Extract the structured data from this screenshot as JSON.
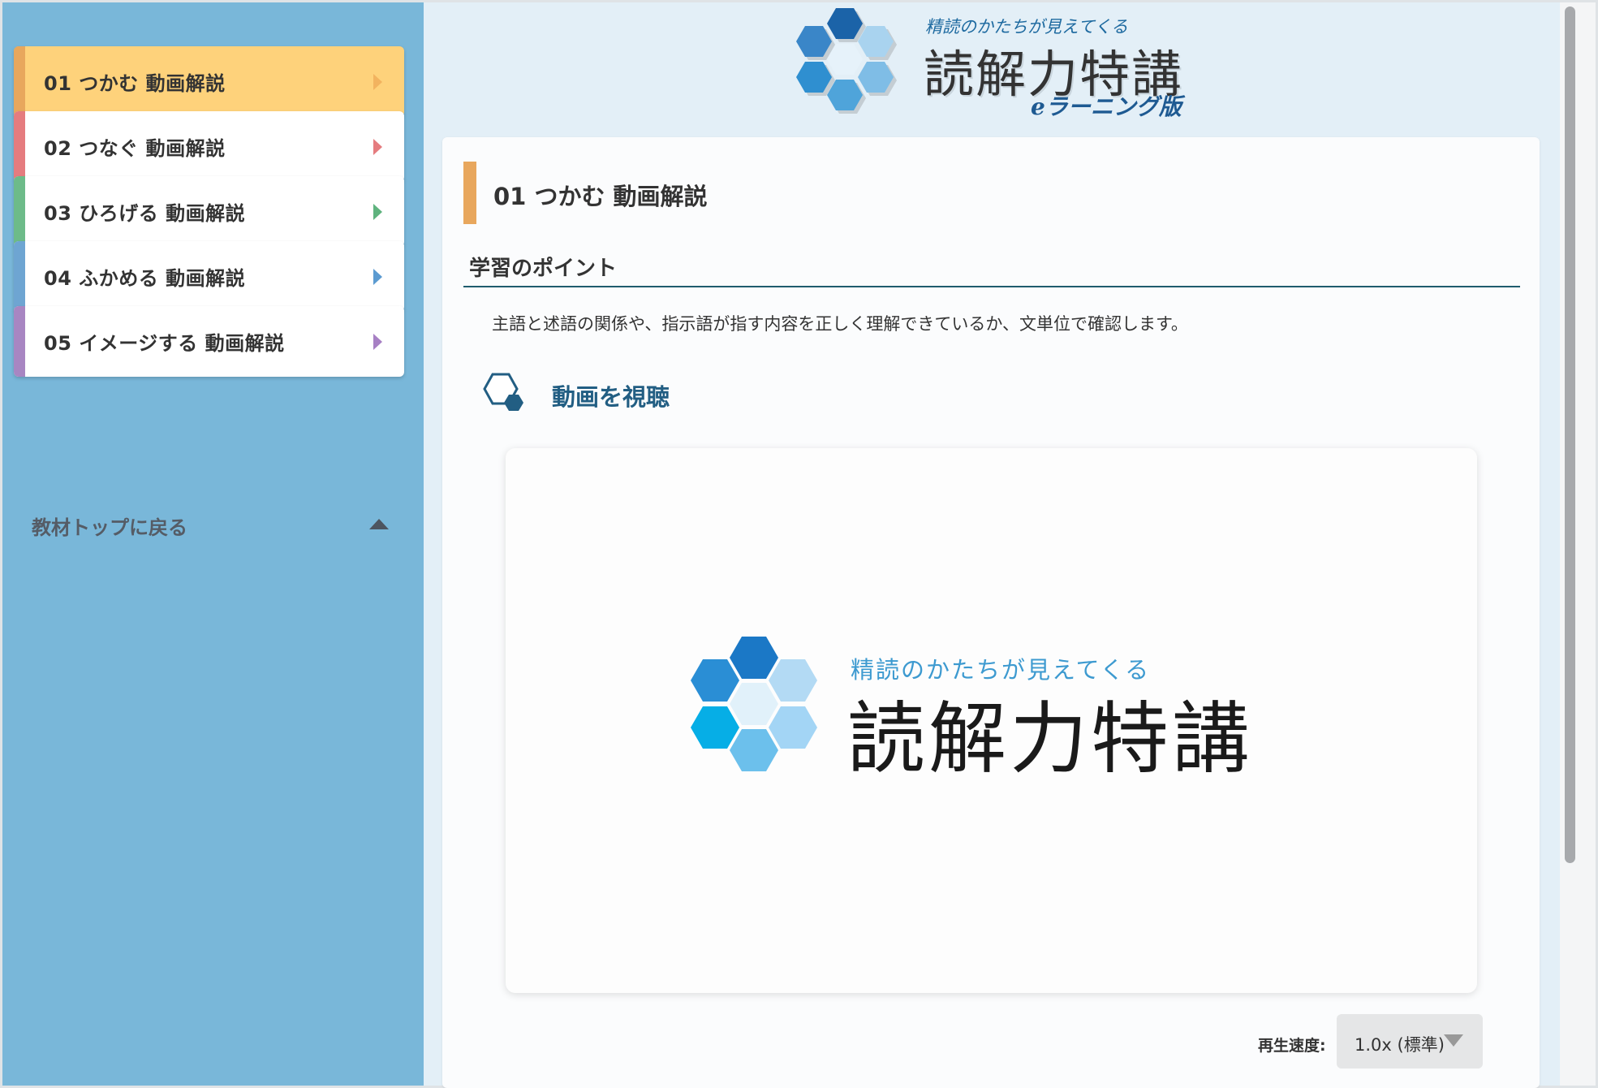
{
  "sidebar": {
    "items": [
      {
        "label": "01 つかむ 動画解説",
        "color": "#e8a75d",
        "arrow_color": "#f2b35f",
        "active": true
      },
      {
        "label": "02 つなぐ 動画解説",
        "color": "#e57c7f",
        "arrow_color": "#e57c7f",
        "active": false
      },
      {
        "label": "03 ひろげる 動画解説",
        "color": "#6dbb89",
        "arrow_color": "#5fb37e",
        "active": false
      },
      {
        "label": "04 ふかめる 動画解説",
        "color": "#6ea5d2",
        "arrow_color": "#5c9bd1",
        "active": false
      },
      {
        "label": "05 イメージする 動画解説",
        "color": "#a886c2",
        "arrow_color": "#a780c4",
        "active": false
      }
    ],
    "back_label": "教材トップに戻る"
  },
  "header": {
    "logo_tagline": "精読のかたちが見えてくる",
    "logo_title": "読解力特講",
    "logo_subtitle": "eラーニング版"
  },
  "main": {
    "title": "01 つかむ 動画解説",
    "section_heading": "学習のポイント",
    "description": "主語と述語の関係や、指示語が指す内容を正しく理解できているか、文単位で確認します。",
    "watch_label": "動画を視聴",
    "video": {
      "tagline": "精読のかたちが見えてくる",
      "title": "読解力特講"
    },
    "speed": {
      "label": "再生速度:",
      "value": "1.0x (標準)"
    }
  },
  "colors": {
    "sidebar_bg": "#79b7d9",
    "active_item_bg": "#fed27b",
    "accent_dark": "#225e83",
    "page_bg": "#e3eff7"
  }
}
